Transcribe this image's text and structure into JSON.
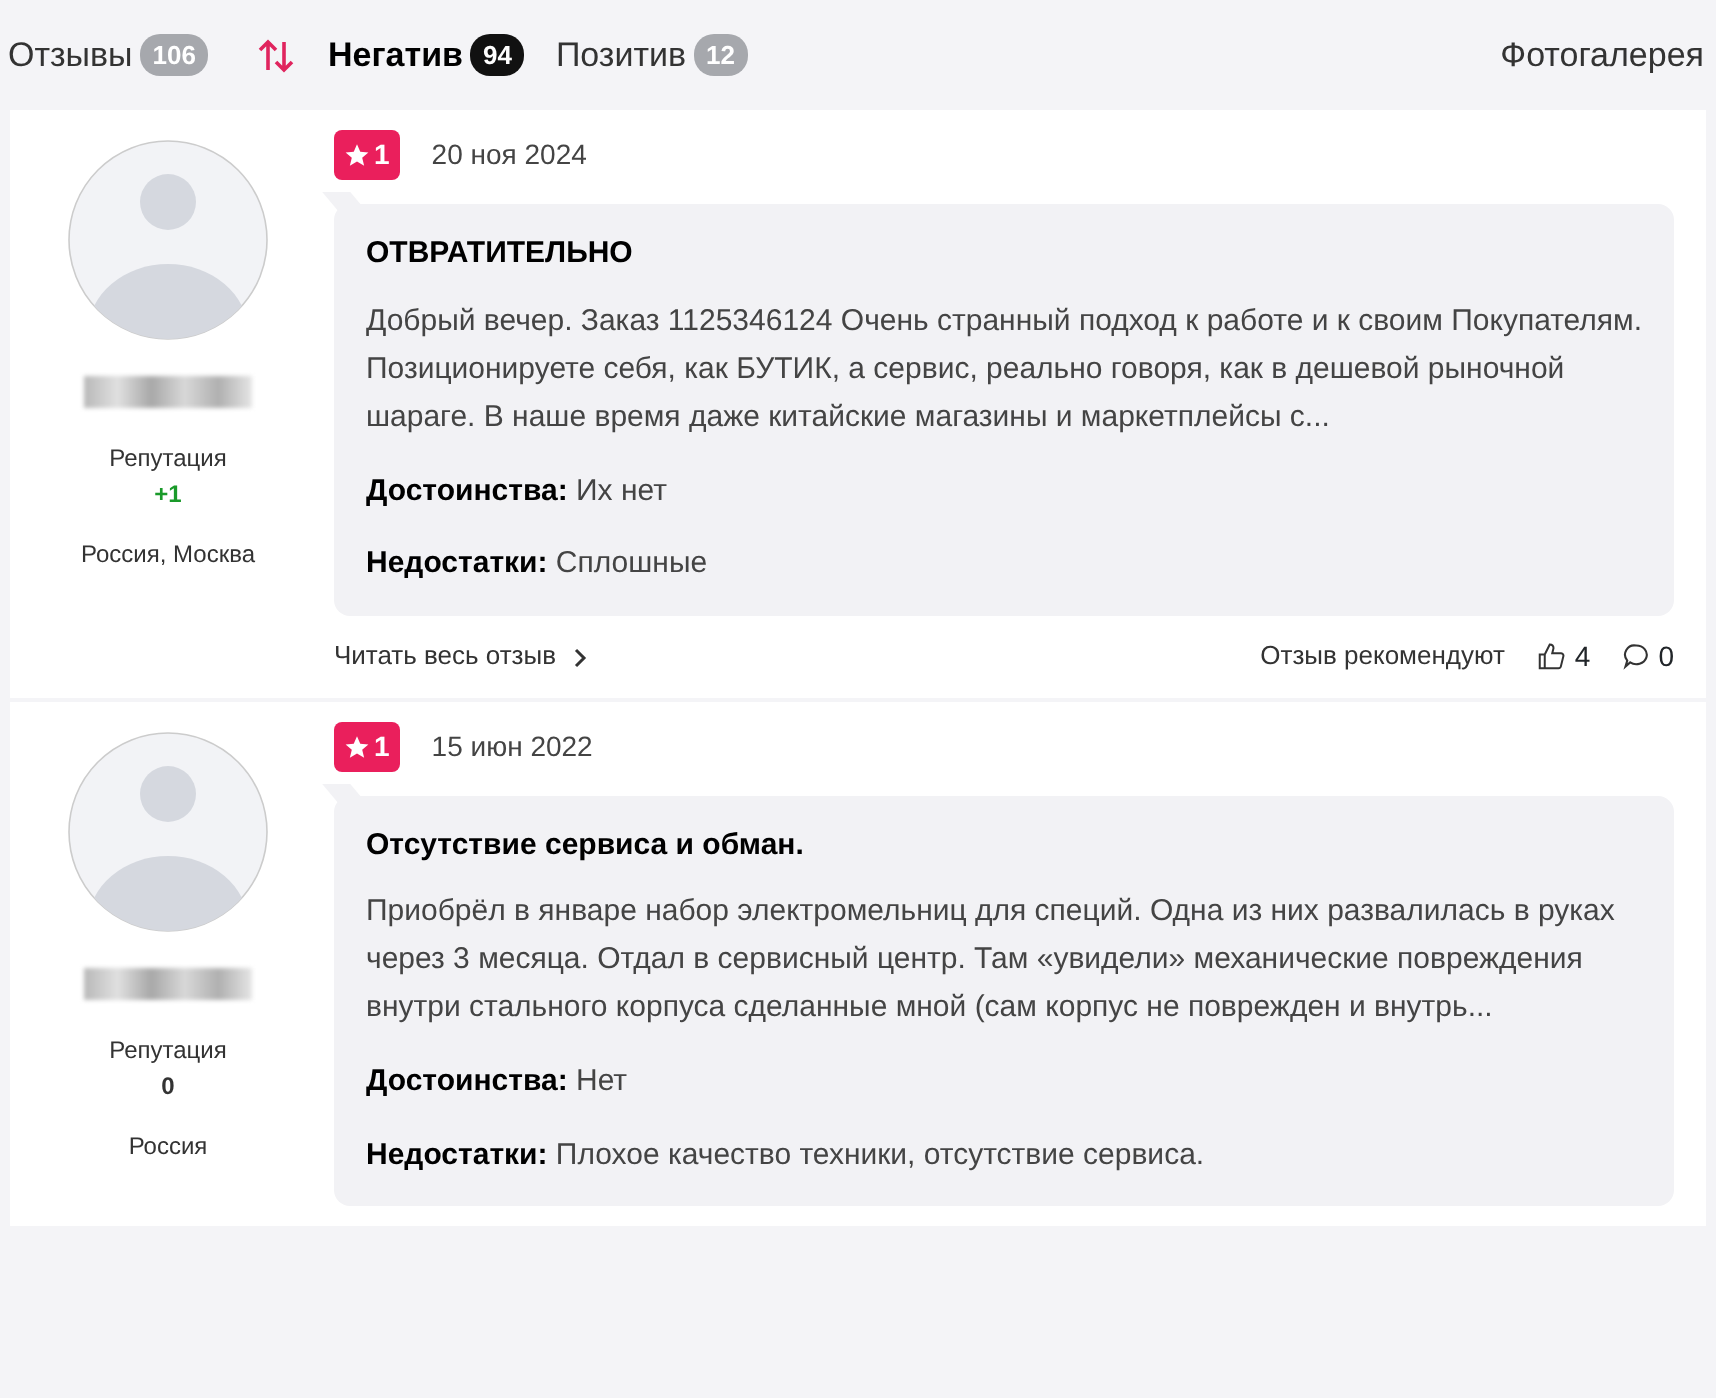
{
  "tabs": [
    {
      "label": "Отзывы",
      "count": "106",
      "selected": false
    },
    {
      "label": "Негатив",
      "count": "94",
      "selected": true
    },
    {
      "label": "Позитив",
      "count": "12",
      "selected": false
    }
  ],
  "gallery_link": "Фотогалерея",
  "reviews": [
    {
      "author": {
        "reputation_label": "Репутация",
        "reputation": "+1",
        "reputation_positive": true,
        "location": "Россия, Москва"
      },
      "rating": "1",
      "date": "20 ноя 2024",
      "title": "ОТВРАТИТЕЛЬНО",
      "text": "Добрый вечер. Заказ 1125346124 Очень странный подход к работе и к своим Покупателям. Позиционируете себя, как БУТИК, а сервис, реально говоря, как в дешевой рыночной шараге. В наше время даже китайские магазины и маркетплейсы с...",
      "pros": "**Достоинства:** Их нет",
      "cons": "**Недостатки:** Сплошные",
      "read_more": "Читать весь отзыв",
      "recommend_label": "Отзыв рекомендуют",
      "likes": "4",
      "comments": "0"
    },
    {
      "author": {
        "reputation_label": "Репутация",
        "reputation": "0",
        "reputation_positive": false,
        "location": "Россия"
      },
      "rating": "1",
      "date": "15 июн 2022",
      "title": "Отсутствие сервиса и обман.",
      "text": "Приобрёл в январе набор электромельниц для специй. Одна из них развалилась в руках через 3 месяца. Отдал в сервисный центр. Там «увидели» механические повреждения внутри стального корпуса сделанные мной (сам корпус не поврежден и внутрь...",
      "pros": "**Достоинства:** Нет",
      "cons": "**Недостатки:** Плохое качество техники, отсутствие сервиса."
    }
  ]
}
